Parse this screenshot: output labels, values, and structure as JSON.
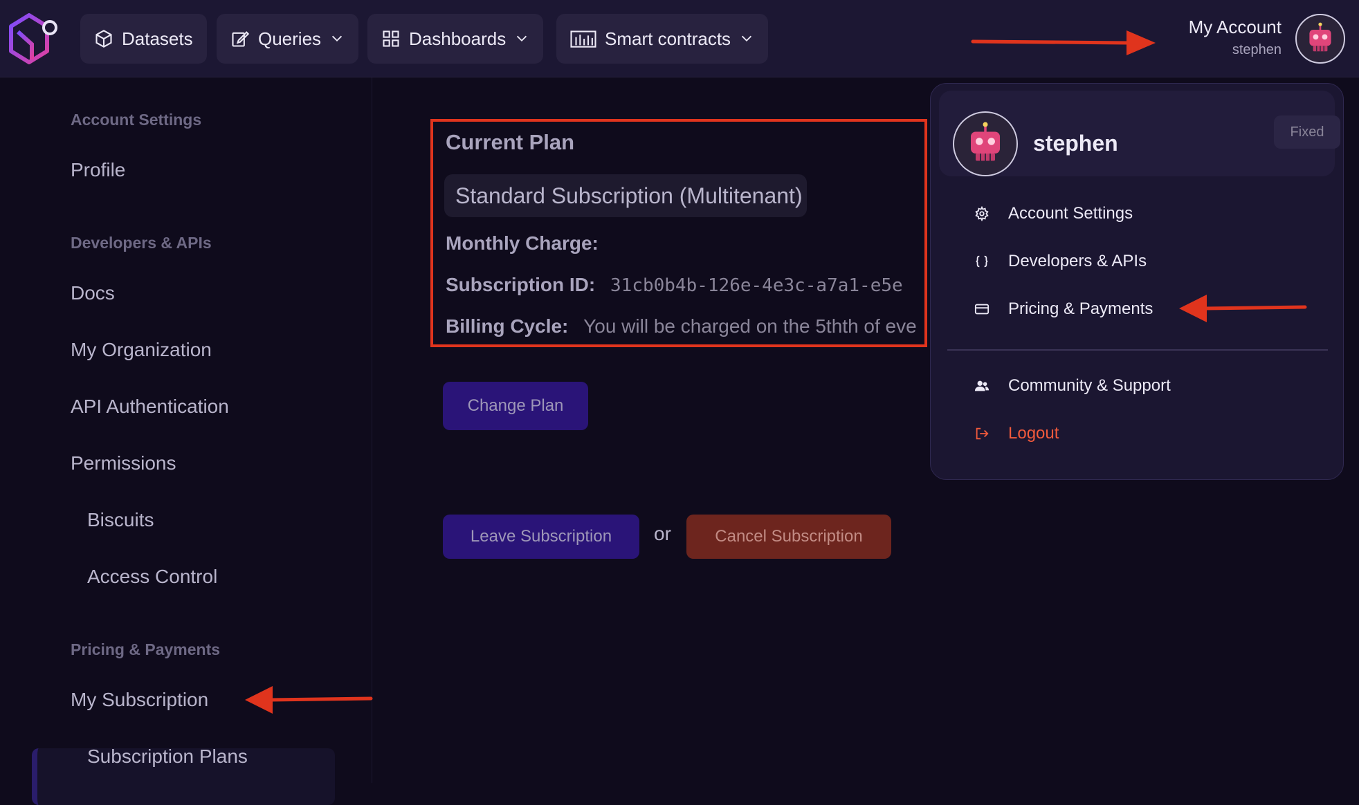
{
  "topbar": {
    "nav": [
      {
        "label": "Datasets"
      },
      {
        "label": "Queries"
      },
      {
        "label": "Dashboards"
      },
      {
        "label": "Smart contracts"
      }
    ],
    "account_title": "My Account",
    "account_user": "stephen"
  },
  "sidebar": {
    "sections": [
      {
        "title": "Account Settings",
        "items": [
          "Profile"
        ]
      },
      {
        "title": "Developers & APIs",
        "items": [
          "Docs",
          "My Organization",
          "API Authentication",
          "Permissions",
          "Biscuits",
          "Access Control"
        ]
      },
      {
        "title": "Pricing & Payments",
        "items": [
          "My Subscription",
          "Subscription Plans"
        ]
      }
    ],
    "active_item": "My Subscription"
  },
  "plan": {
    "title": "Current Plan",
    "name": "Standard Subscription (Multitenant)",
    "monthly_label": "Monthly Charge:",
    "monthly_value": "",
    "subscription_id_label": "Subscription ID:",
    "subscription_id_value": "31cb0b4b-126e-4e3c-a7a1-e5e",
    "billing_label": "Billing Cycle:",
    "billing_value": "You will be charged on the 5thth of eve"
  },
  "actions": {
    "change_plan": "Change Plan",
    "leave": "Leave Subscription",
    "or": "or",
    "cancel": "Cancel Subscription"
  },
  "dropdown": {
    "username": "stephen",
    "badge": "Fixed",
    "items": [
      {
        "label": "Account Settings",
        "icon": "gear-icon"
      },
      {
        "label": "Developers & APIs",
        "icon": "braces-icon"
      },
      {
        "label": "Pricing & Payments",
        "icon": "card-icon"
      },
      {
        "label": "Community & Support",
        "icon": "people-icon"
      },
      {
        "label": "Logout",
        "icon": "logout-icon"
      }
    ]
  },
  "colors": {
    "annotation_red": "#e0341d",
    "brand_purple": "#2a1478",
    "logout_red": "#f25a3c"
  }
}
